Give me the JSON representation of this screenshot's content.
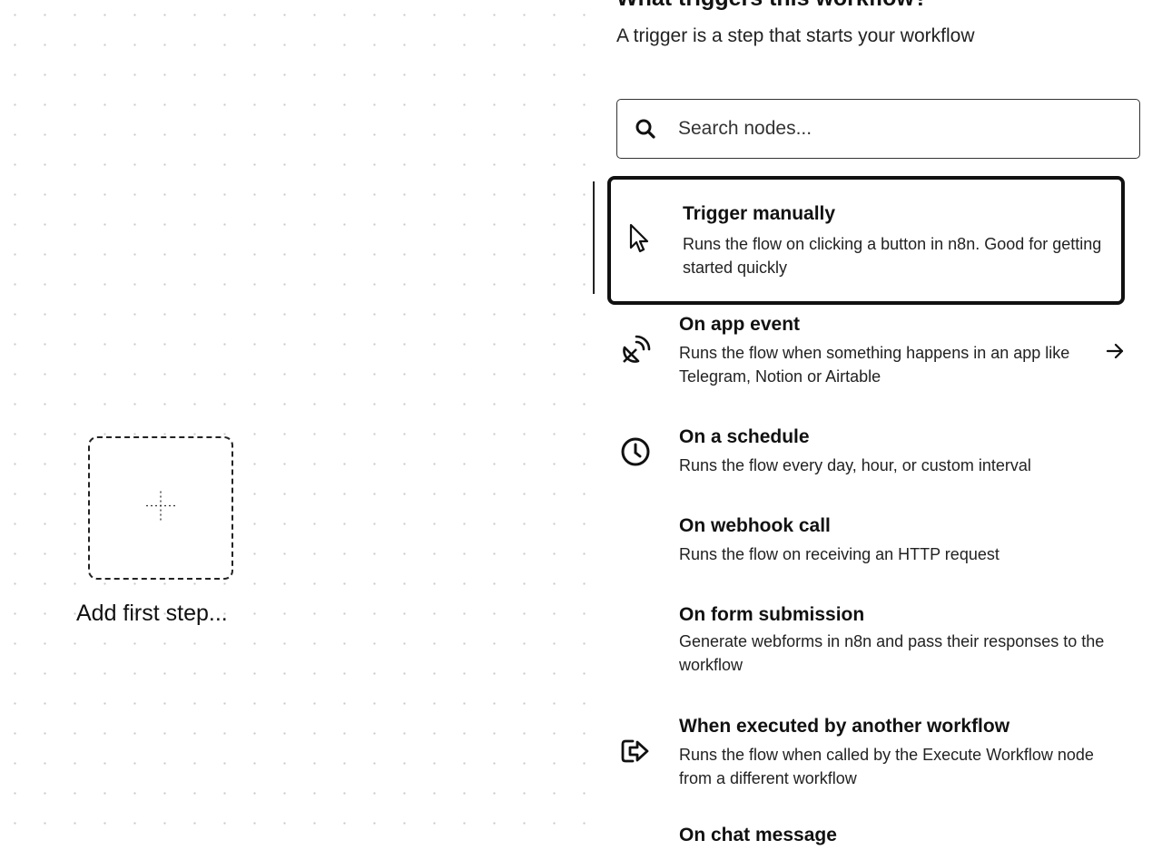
{
  "canvas": {
    "add_step_label": "Add first step..."
  },
  "panel": {
    "title": "What triggers this workflow?",
    "subtitle": "A trigger is a step that starts your workflow",
    "search": {
      "placeholder": "Search nodes...",
      "value": ""
    },
    "items": [
      {
        "title": "Trigger manually",
        "description": "Runs the flow on clicking a button in n8n. Good for getting started quickly",
        "icon": "cursor-icon",
        "selected": true
      },
      {
        "title": "On app event",
        "description": "Runs the flow when something happens in an app like Telegram, Notion or Airtable",
        "icon": "satellite-dish-icon",
        "has_arrow": true
      },
      {
        "title": "On a schedule",
        "description": "Runs the flow every day, hour, or custom interval",
        "icon": "clock-icon"
      },
      {
        "title": "On webhook call",
        "description": "Runs the flow on receiving an HTTP request",
        "icon": ""
      },
      {
        "title": "On form submission",
        "description": "Generate webforms in n8n and pass their responses to the workflow",
        "icon": ""
      },
      {
        "title": "When executed by another workflow",
        "description": "Runs the flow when called by the Execute Workflow node from a different workflow",
        "icon": "sign-in-icon"
      },
      {
        "title": "On chat message",
        "description": "",
        "icon": ""
      }
    ]
  }
}
